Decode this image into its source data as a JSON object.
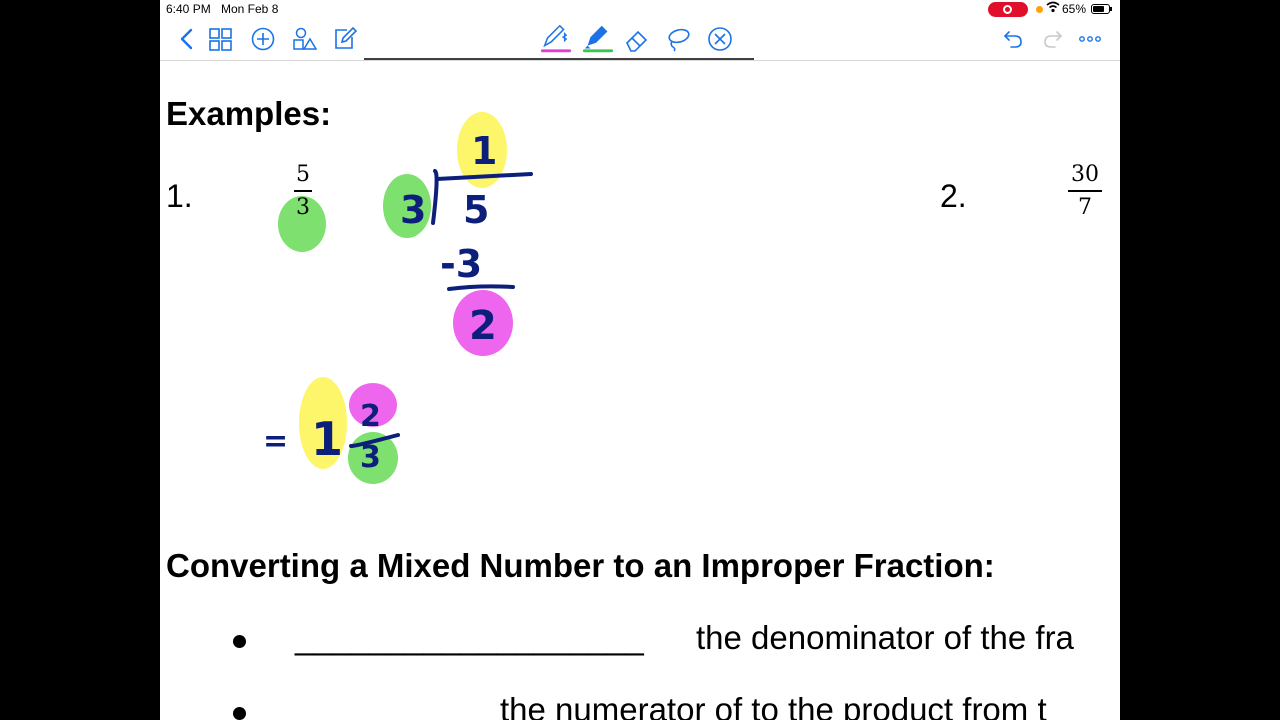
{
  "status": {
    "time": "6:40 PM",
    "date": "Mon Feb 8",
    "battery": "65%"
  },
  "content": {
    "heading_examples": "Examples:",
    "ex1_num": "1.",
    "ex1_numerator": "5",
    "ex1_denominator": "3",
    "ex2_num": "2.",
    "ex2_numerator": "30",
    "ex2_denominator": "7",
    "heading_mixed": "Converting a Mixed Number to an Improper Fraction:",
    "bullet1_blank": "___________________",
    "bullet1_text": "the denominator of the fra",
    "bullet2_text": "the numerator of to the product from t"
  },
  "handwriting": {
    "divisor": "3",
    "dividend": "5",
    "quotient": "1",
    "subtract": "-3",
    "remainder": "2",
    "equals": "=",
    "whole": "1",
    "mixed_num": "2",
    "mixed_den": "3"
  },
  "colors": {
    "ink": "#0c1f7a",
    "yellow": "#fdf56a",
    "green": "#7ee06e",
    "magenta": "#ee66ee",
    "accent": "#1a73e8"
  }
}
